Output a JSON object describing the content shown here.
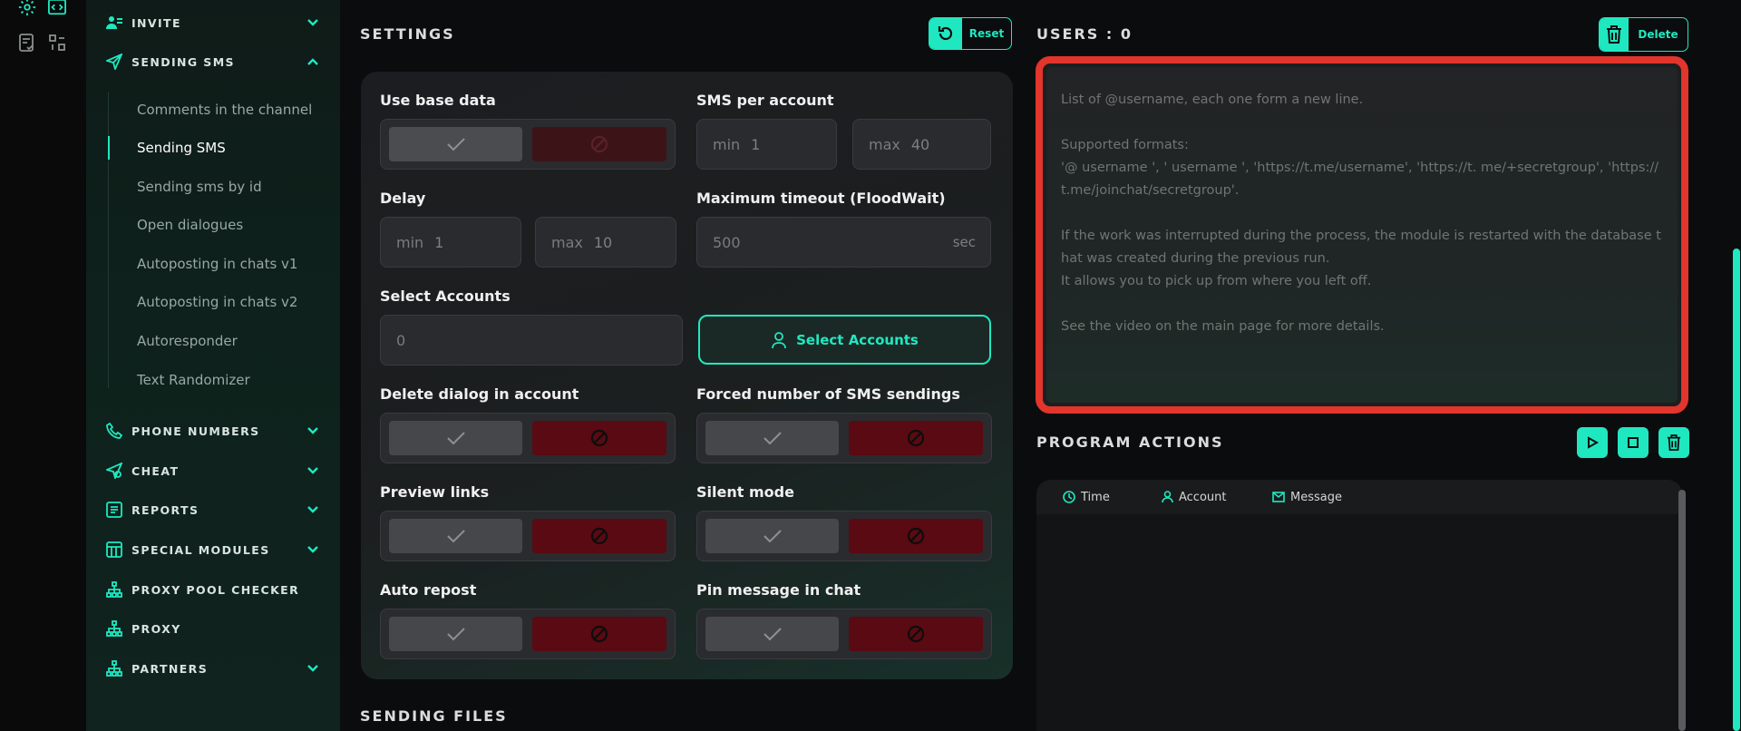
{
  "sidebar": {
    "sections": [
      {
        "label": "INVITE"
      },
      {
        "label": "SENDING SMS"
      },
      {
        "label": "PHONE NUMBERS"
      },
      {
        "label": "CHEAT"
      },
      {
        "label": "REPORTS"
      },
      {
        "label": "SPECIAL MODULES"
      },
      {
        "label": "PROXY POOL CHECKER"
      },
      {
        "label": "PROXY"
      },
      {
        "label": "PARTNERS"
      }
    ],
    "sub_items": [
      {
        "label": "Comments in the channel"
      },
      {
        "label": "Sending SMS"
      },
      {
        "label": "Sending sms by id"
      },
      {
        "label": "Open dialogues"
      },
      {
        "label": "Autoposting in chats v1"
      },
      {
        "label": "Autoposting in chats v2"
      },
      {
        "label": "Autoresponder"
      },
      {
        "label": "Text Randomizer"
      }
    ],
    "active_sub_item": "Sending SMS"
  },
  "settings": {
    "title": "SETTINGS",
    "reset_label": "Reset",
    "use_base_data_label": "Use base data",
    "sms_per_account_label": "SMS per account",
    "sms_min_label": "min",
    "sms_min_value": "1",
    "sms_max_label": "max",
    "sms_max_value": "40",
    "delay_label": "Delay",
    "delay_min_label": "min",
    "delay_min_value": "1",
    "delay_max_label": "max",
    "delay_max_value": "10",
    "max_timeout_label": "Maximum timeout (FloodWait)",
    "max_timeout_value": "500",
    "max_timeout_unit": "sec",
    "select_accounts_label": "Select Accounts",
    "select_accounts_value": "0",
    "select_accounts_button": "Select Accounts",
    "delete_dialog_label": "Delete dialog in account",
    "forced_number_label": "Forced number of SMS sendings",
    "preview_links_label": "Preview links",
    "silent_mode_label": "Silent mode",
    "auto_repost_label": "Auto repost",
    "pin_message_label": "Pin message in chat"
  },
  "sending_files": {
    "title": "SENDING FILES"
  },
  "users": {
    "title": "USERS : 0",
    "delete_label": "Delete",
    "placeholder": "List of @username, each one form a new line.\n\nSupported formats:\n'@ username ', ' username ', 'https://t.me/username', 'https://t. me/+secretgroup', 'https://t.me/joinchat/secretgroup'.\n\nIf the work was interrupted during the process, the module is restarted with the database that was created during the previous run.\nIt allows you to pick up from where you left off.\n\nSee the video on the main page for more details."
  },
  "program_actions": {
    "title": "PROGRAM ACTIONS",
    "columns": [
      "Time",
      "Account",
      "Message"
    ]
  },
  "colors": {
    "accent": "#1fe8c0",
    "danger": "#5a0a12",
    "highlight": "#e2352b"
  }
}
